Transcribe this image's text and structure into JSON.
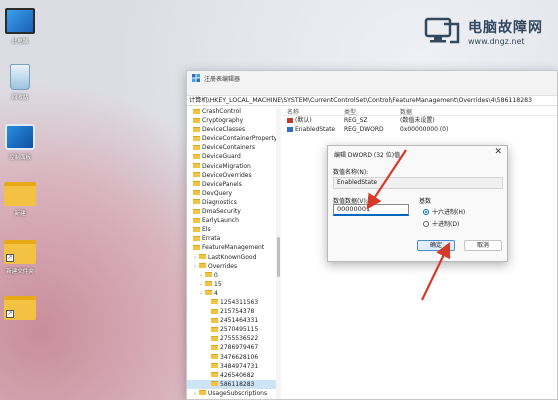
{
  "desktop": {
    "icons": [
      {
        "label": "此电脑",
        "icon": "computer-icon"
      },
      {
        "label": "回收站",
        "icon": "recycle-bin-icon"
      },
      {
        "label": "控制面板",
        "icon": "control-panel-icon"
      },
      {
        "label": "新建",
        "icon": "folder-icon"
      },
      {
        "label": "新建文件夹",
        "icon": "folder-shortcut-icon"
      },
      {
        "label": "",
        "icon": "folder-shortcut-icon"
      }
    ]
  },
  "watermark": {
    "title": "电脑故障网",
    "url": "www.dngz.net"
  },
  "regedit": {
    "title": "注册表编辑器",
    "address": "计算机\\HKEY_LOCAL_MACHINE\\SYSTEM\\CurrentControlSet\\Control\\FeatureManagement\\Overrides\\4\\586118283",
    "tree": [
      {
        "label": "CrashControl",
        "depth": 0
      },
      {
        "label": "Cryptography",
        "depth": 0
      },
      {
        "label": "DeviceClasses",
        "depth": 0
      },
      {
        "label": "DeviceContainerPropertyUpda",
        "depth": 0
      },
      {
        "label": "DeviceContainers",
        "depth": 0
      },
      {
        "label": "DeviceGuard",
        "depth": 0
      },
      {
        "label": "DeviceMigration",
        "depth": 0
      },
      {
        "label": "DeviceOverrides",
        "depth": 0
      },
      {
        "label": "DevicePanels",
        "depth": 0
      },
      {
        "label": "DevQuery",
        "depth": 0
      },
      {
        "label": "Diagnostics",
        "depth": 0
      },
      {
        "label": "DmaSecurity",
        "depth": 0
      },
      {
        "label": "EarlyLaunch",
        "depth": 0
      },
      {
        "label": "Els",
        "depth": 0
      },
      {
        "label": "Errata",
        "depth": 0
      },
      {
        "label": "FeatureManagement",
        "depth": 0
      },
      {
        "label": "LastKnownGood",
        "depth": 1
      },
      {
        "label": "Overrides",
        "depth": 1
      },
      {
        "label": "0",
        "depth": 2
      },
      {
        "label": "15",
        "depth": 2
      },
      {
        "label": "4",
        "depth": 2
      },
      {
        "label": "1254311563",
        "depth": 3
      },
      {
        "label": "215754378",
        "depth": 3
      },
      {
        "label": "2451464331",
        "depth": 3
      },
      {
        "label": "2570495115",
        "depth": 3
      },
      {
        "label": "2755536522",
        "depth": 3
      },
      {
        "label": "2786979467",
        "depth": 3
      },
      {
        "label": "3476628106",
        "depth": 3
      },
      {
        "label": "3484974731",
        "depth": 3
      },
      {
        "label": "426540682",
        "depth": 3
      },
      {
        "label": "586118283",
        "depth": 3,
        "selected": true
      },
      {
        "label": "UsageSubscriptions",
        "depth": 1
      }
    ],
    "columns": {
      "name": "名称",
      "type": "类型",
      "data": "数据"
    },
    "values": [
      {
        "name": "(默认)",
        "type": "REG_SZ",
        "data": "(数值未设置)",
        "icon": "string-value-icon"
      },
      {
        "name": "EnabledState",
        "type": "REG_DWORD",
        "data": "0x00000000 (0)",
        "icon": "dword-value-icon"
      }
    ]
  },
  "dialog": {
    "title": "编辑 DWORD (32 位)值",
    "close_glyph": "✕",
    "name_label": "数值名称(N):",
    "name_value": "EnabledState",
    "data_label": "数值数据(V):",
    "data_value": "00000001",
    "base_label": "基数",
    "base_options": [
      {
        "label": "十六进制(H)",
        "checked": true
      },
      {
        "label": "十进制(D)",
        "checked": false
      }
    ],
    "ok_label": "确定",
    "cancel_label": "取消"
  },
  "colors": {
    "accent": "#0067c0",
    "arrow": "#d63a2a",
    "selection": "#cde4f7"
  }
}
